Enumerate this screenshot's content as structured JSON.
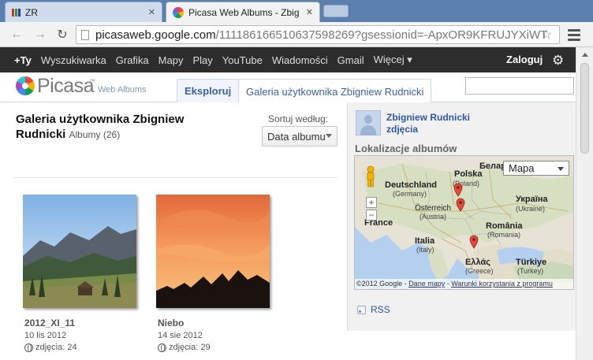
{
  "browser": {
    "tabs": [
      {
        "title": "ZR",
        "active": false
      },
      {
        "title": "Picasa Web Albums - Zbig",
        "active": true
      }
    ],
    "url_host": "picasaweb.google.com",
    "url_path": "/111186166510637598269?gsessionid=-ApxOR9KFRUJYXiWT"
  },
  "google_bar": {
    "items": [
      "+Ty",
      "Wyszukiwarka",
      "Grafika",
      "Mapy",
      "Play",
      "YouTube",
      "Wiadomości",
      "Gmail",
      "Więcej ▾"
    ],
    "login": "Zaloguj"
  },
  "picasa": {
    "logo": "Picasa",
    "logo_sub": "Web Albums",
    "tabs": [
      {
        "label": "Eksploruj",
        "selected": false
      },
      {
        "label": "Galeria użytkownika Zbigniew Rudnicki",
        "selected": true
      }
    ]
  },
  "gallery": {
    "title": "Galeria użytkownika Zbigniew Rudnicki",
    "count_label": "Albumy (26)",
    "sort_label": "Sortuj według:",
    "sort_value": "Data albumu",
    "albums": [
      {
        "title": "2012_XI_11",
        "date": "10 lis 2012",
        "count": "zdjęcia: 24"
      },
      {
        "title": "Niebo",
        "date": "14 sie 2012",
        "count": "zdjęcia: 29"
      }
    ]
  },
  "sidebar": {
    "user_name": "Zbigniew Rudnicki",
    "user_photos": "zdjęcia",
    "locations_title": "Lokalizacje albumów",
    "map_type": "Mapa",
    "map_labels": {
      "polska": "Polska",
      "poland": "(Poland)",
      "belarus": "Беларус",
      "deutschland": "Deutschland",
      "germany": "(Germany)",
      "osterreich": "Österreich",
      "austria": "(Austria)",
      "ukraina": "Україна",
      "ukraine": "(Ukraine)",
      "france": "France",
      "romania": "România",
      "romania_en": "(Romania)",
      "italia": "Italia",
      "italy": "(Italy)",
      "ellas": "Ελλάς",
      "greece": "(Greece)",
      "turkiye": "Türkiye",
      "turkey": "(Turkey)"
    },
    "map_footer": {
      "copyright": "©2012 Google - ",
      "data_link": "Dane mapy",
      "sep": " - ",
      "terms_link": "Warunki korzystania z programu"
    },
    "rss": "RSS"
  },
  "colors": {
    "link": "#2f57a5",
    "gbar_bg": "#2d2d2d",
    "marker": "#e24a3b"
  }
}
